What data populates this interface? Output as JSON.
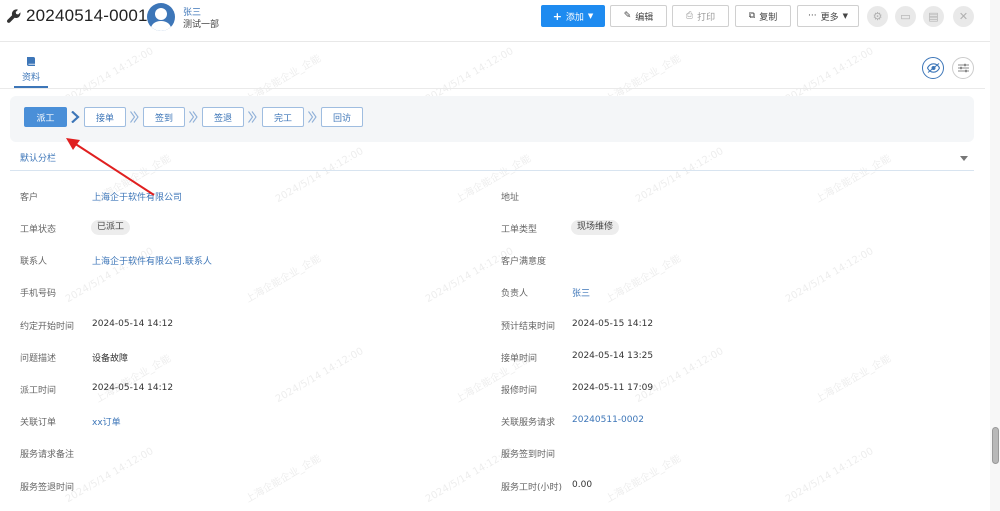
{
  "header": {
    "record_no": "20240514-0001",
    "user_name": "张三",
    "user_dept": "测试一部",
    "buttons": {
      "add": "添加",
      "edit": "编辑",
      "print": "打印",
      "copy": "复制",
      "more": "更多"
    }
  },
  "tabs": [
    {
      "label": "资料",
      "icon": "book-icon"
    }
  ],
  "workflow": {
    "steps": [
      "派工",
      "接单",
      "签到",
      "签退",
      "完工",
      "回访"
    ],
    "active_index": 0
  },
  "section": {
    "title": "默认分栏"
  },
  "fields": {
    "customer": {
      "label": "客户",
      "value": "上海企于软件有限公司"
    },
    "address": {
      "label": "地址",
      "value": ""
    },
    "status": {
      "label": "工单状态",
      "value": "已派工"
    },
    "type": {
      "label": "工单类型",
      "value": "现场维修"
    },
    "contact": {
      "label": "联系人",
      "value": "上海企于软件有限公司.联系人"
    },
    "satisfaction": {
      "label": "客户满意度",
      "value": ""
    },
    "phone": {
      "label": "手机号码",
      "value": ""
    },
    "owner": {
      "label": "负责人",
      "value": "张三"
    },
    "planned_start": {
      "label": "约定开始时间",
      "value": "2024-05-14 14:12"
    },
    "planned_end": {
      "label": "预计结束时间",
      "value": "2024-05-15 14:12"
    },
    "problem": {
      "label": "问题描述",
      "value": "设备故障"
    },
    "accept_time": {
      "label": "接单时间",
      "value": "2024-05-14 13:25"
    },
    "dispatch_time": {
      "label": "派工时间",
      "value": "2024-05-14 14:12"
    },
    "report_time": {
      "label": "报修时间",
      "value": "2024-05-11 17:09"
    },
    "related_order": {
      "label": "关联订单",
      "value": "xx订单"
    },
    "related_request": {
      "label": "关联服务请求",
      "value": "20240511-0002"
    },
    "request_note": {
      "label": "服务请求备注",
      "value": ""
    },
    "checkin_time": {
      "label": "服务签到时间",
      "value": ""
    },
    "checkout_time": {
      "label": "服务签退时间",
      "value": ""
    },
    "work_hours": {
      "label": "服务工时(小时)",
      "value": "0.00"
    }
  },
  "watermark": {
    "company": "上海企能企业_企能",
    "time": "2024/5/14 14:12:00"
  },
  "colors": {
    "primary": "#1e8bf0",
    "link": "#3d76b8",
    "active_step": "#4a8fd8",
    "annotation_arrow": "#e02020"
  }
}
